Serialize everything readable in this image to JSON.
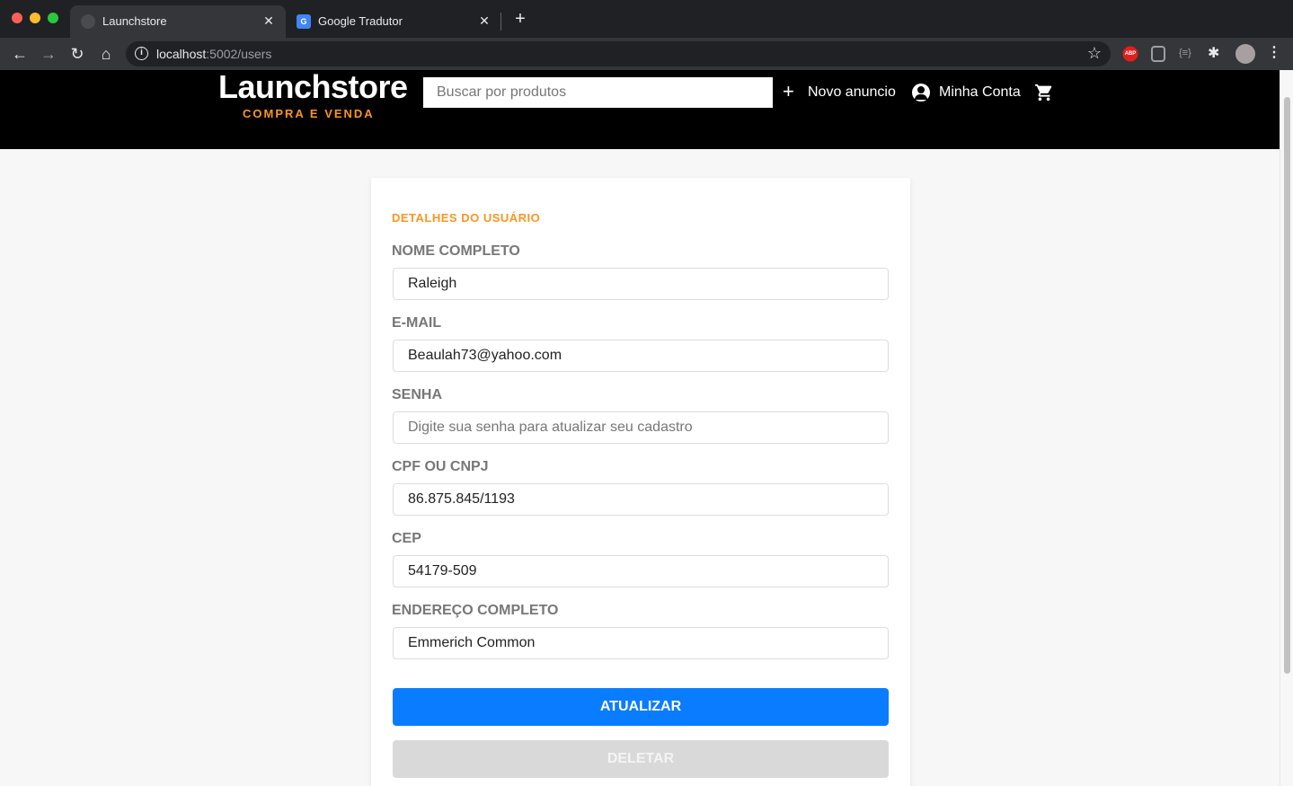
{
  "browser": {
    "tabs": [
      {
        "title": "Launchstore",
        "active": true
      },
      {
        "title": "Google Tradutor",
        "active": false
      }
    ],
    "url_host": "localhost",
    "url_rest": ":5002/users",
    "extensions": {
      "abp": "ABP",
      "json": "{≡}"
    }
  },
  "header": {
    "logo_title": "Launchstore",
    "logo_subtitle": "COMPRA E VENDA",
    "search_placeholder": "Buscar por produtos",
    "new_ad_label": "Novo anuncio",
    "account_label": "Minha Conta"
  },
  "form": {
    "section_title": "DETALHES DO USUÁRIO",
    "fields": [
      {
        "label": "NOME COMPLETO",
        "value": "Raleigh",
        "placeholder": ""
      },
      {
        "label": "E-MAIL",
        "value": "Beaulah73@yahoo.com",
        "placeholder": ""
      },
      {
        "label": "SENHA",
        "value": "",
        "placeholder": "Digite sua senha para atualizar seu cadastro"
      },
      {
        "label": "CPF OU CNPJ",
        "value": "86.875.845/1193",
        "placeholder": ""
      },
      {
        "label": "CEP",
        "value": "54179-509",
        "placeholder": ""
      },
      {
        "label": "ENDEREÇO COMPLETO",
        "value": "Emmerich Common",
        "placeholder": ""
      }
    ],
    "update_label": "ATUALIZAR",
    "delete_label": "DELETAR"
  },
  "colors": {
    "accent": "#fd951f",
    "primary_button": "#0a7cff",
    "disabled_button": "#d9d9d9"
  }
}
